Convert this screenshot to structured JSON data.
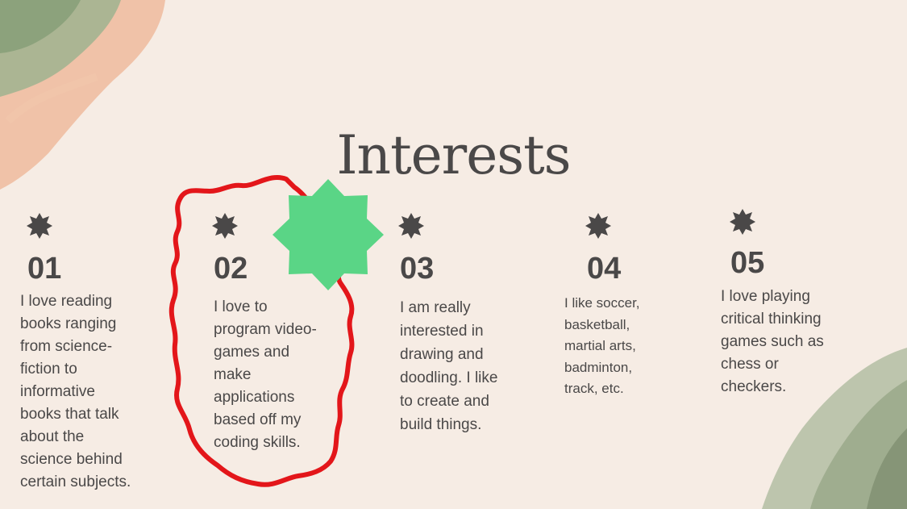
{
  "slide": {
    "title": "Interests",
    "colors": {
      "background": "#f6ece4",
      "text": "#4a4848",
      "accent_star": "#5ad586",
      "scribble": "#e3161a"
    },
    "items": [
      {
        "number": "01",
        "lines": [
          "I love reading",
          "books ranging",
          "from science-",
          "fiction to",
          "informative",
          "books that talk",
          "about the",
          "science behind",
          "certain subjects."
        ]
      },
      {
        "number": "02",
        "lines": [
          "I love to",
          "program video-",
          "games and",
          "make",
          "applications",
          "based off my",
          "coding skills."
        ]
      },
      {
        "number": "03",
        "lines": [
          "I am really",
          "interested in",
          "drawing and",
          "doodling. I like",
          "to create and",
          "build things."
        ]
      },
      {
        "number": "04",
        "lines": [
          "I like soccer,",
          "basketball,",
          "martial arts,",
          "badminton,",
          "track, etc."
        ]
      },
      {
        "number": "05",
        "lines": [
          "I love playing",
          "critical thinking",
          "games such as",
          "chess or",
          "checkers."
        ]
      }
    ]
  }
}
